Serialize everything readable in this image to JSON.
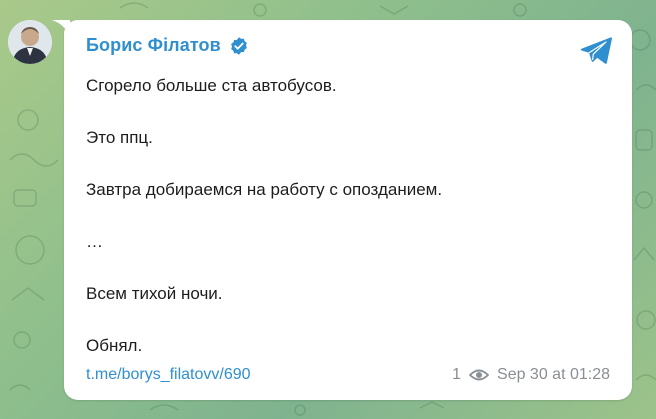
{
  "post": {
    "author": "Борис Філатов",
    "lines": [
      "Сгорело больше ста автобусов.",
      "Это ппц.",
      "Завтра добираемся на работу с опозданием.",
      "…",
      "Всем тихой ночи.",
      "Обнял."
    ],
    "link": "t.me/borys_filatovv/690",
    "views": "1",
    "timestamp": "Sep 30 at 01:28"
  },
  "icons": {
    "verified": "verified-badge-icon",
    "share": "telegram-plane-icon",
    "views": "eye-icon",
    "avatar": "author-avatar"
  },
  "colors": {
    "accent": "#2f8fcf",
    "background": "#8fbf8c",
    "bubble": "#ffffff",
    "text": "#1d1d1d",
    "meta": "#8a8f95"
  }
}
